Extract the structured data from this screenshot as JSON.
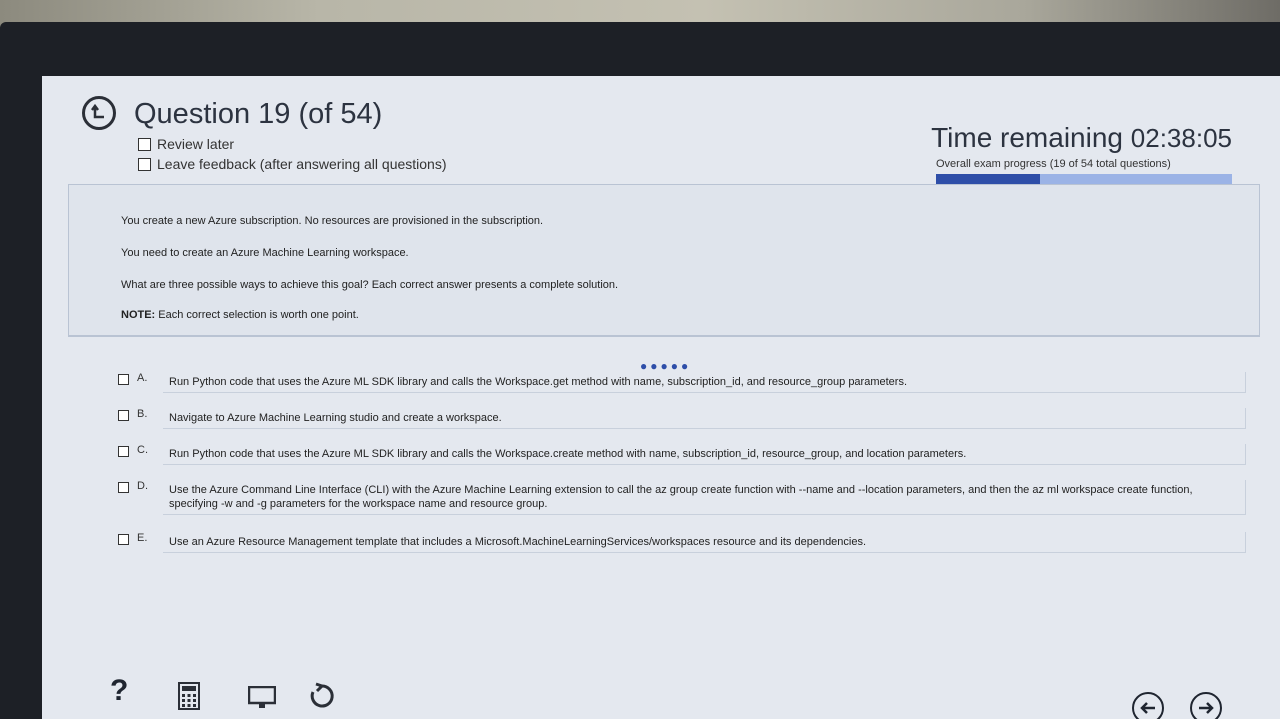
{
  "header": {
    "question_title": "Question 19 (of 54)",
    "review_later": "Review later",
    "leave_feedback": "Leave feedback (after answering all questions)",
    "time_remaining_label": "Time remaining",
    "time_remaining_value": "02:38:05",
    "progress_text": "Overall exam progress (19 of 54 total questions)",
    "progress_fraction": 0.352
  },
  "question": {
    "line1": "You create a new Azure subscription. No resources are provisioned in the subscription.",
    "line2": "You need to create an Azure Machine Learning workspace.",
    "line3": "What are three possible ways to achieve this goal? Each correct answer presents a complete solution.",
    "note_label": "NOTE:",
    "note_text": "Each correct selection is worth one point."
  },
  "options": [
    {
      "letter": "A.",
      "text": "Run Python code that uses the Azure ML SDK library and calls the Workspace.get method with name, subscription_id, and resource_group parameters."
    },
    {
      "letter": "B.",
      "text": "Navigate to Azure Machine Learning studio and create a workspace."
    },
    {
      "letter": "C.",
      "text": "Run Python code that uses the Azure ML SDK library and calls the Workspace.create method with name, subscription_id, resource_group, and location parameters."
    },
    {
      "letter": "D.",
      "text": "Use the Azure Command Line Interface (CLI) with the Azure Machine Learning extension to call the az group create function with --name and --location parameters, and then the az ml workspace create function, specifying -w and -g parameters for the workspace name and resource group."
    },
    {
      "letter": "E.",
      "text": "Use an Azure Resource Management template that includes a Microsoft.MachineLearningServices/workspaces resource and its dependencies."
    }
  ],
  "toolbar": {
    "help_glyph": "?",
    "icons": [
      "help-icon",
      "calculator-icon",
      "screen-icon",
      "reset-icon",
      "previous-icon",
      "next-icon"
    ]
  },
  "colors": {
    "progress_fill": "#2e4ea8",
    "progress_track": "#9bb3e6",
    "screen_bg": "#e4e8ef"
  }
}
